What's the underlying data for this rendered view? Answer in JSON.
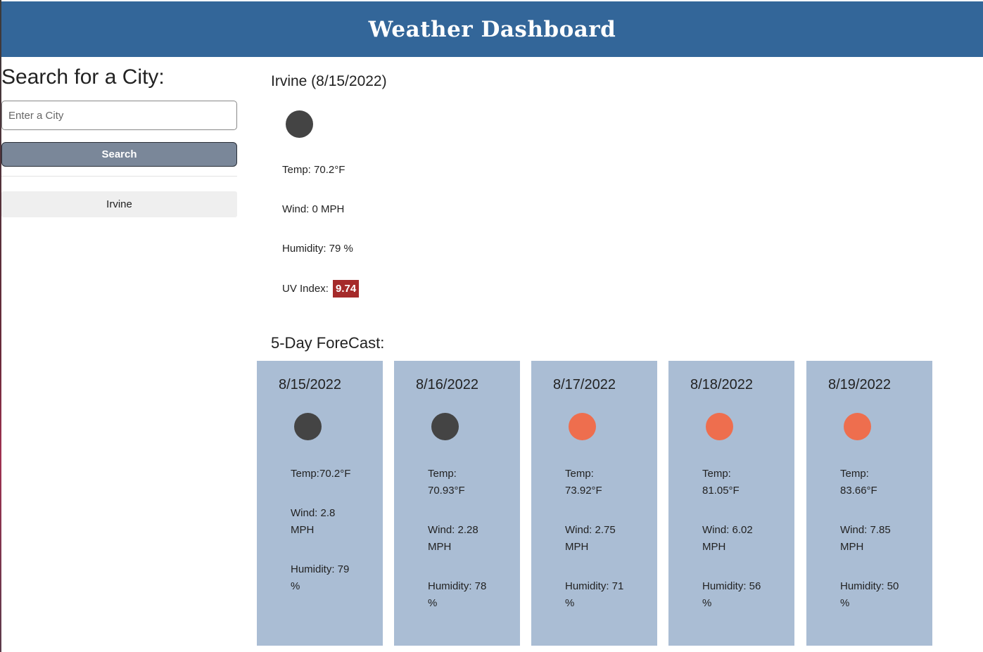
{
  "header": {
    "title": "Weather Dashboard"
  },
  "search": {
    "heading": "Search for a City:",
    "placeholder": "Enter a City",
    "button_label": "Search"
  },
  "history": [
    {
      "label": "Irvine"
    }
  ],
  "current": {
    "title": "Irvine (8/15/2022)",
    "icon": "weather-icon",
    "icon_color": "#444444",
    "temp": "Temp: 70.2°F",
    "wind": "Wind: 0 MPH",
    "humidity": "Humidity: 79 %",
    "uv_label": "UV Index:",
    "uv_value": "9.74",
    "uv_color": "#a52a2a"
  },
  "forecast": {
    "title": "5-Day ForeCast:",
    "days": [
      {
        "date": "8/15/2022",
        "icon_color": "#444444",
        "temp_label": "Temp:",
        "temp_value": "70.2°F",
        "wind_label": "Wind: 2.8",
        "wind_unit": "MPH",
        "humidity_label": "Humidity: 79",
        "humidity_unit": "%"
      },
      {
        "date": "8/16/2022",
        "icon_color": "#444444",
        "temp_label": "Temp:",
        "temp_value": "70.93°F",
        "wind_label": "Wind: 2.28",
        "wind_unit": "MPH",
        "humidity_label": "Humidity: 78",
        "humidity_unit": "%"
      },
      {
        "date": "8/17/2022",
        "icon_color": "#ee6e4e",
        "temp_label": "Temp:",
        "temp_value": "73.92°F",
        "wind_label": "Wind: 2.75",
        "wind_unit": "MPH",
        "humidity_label": "Humidity: 71",
        "humidity_unit": "%"
      },
      {
        "date": "8/18/2022",
        "icon_color": "#ee6e4e",
        "temp_label": "Temp:",
        "temp_value": "81.05°F",
        "wind_label": "Wind: 6.02",
        "wind_unit": "MPH",
        "humidity_label": "Humidity: 56",
        "humidity_unit": "%"
      },
      {
        "date": "8/19/2022",
        "icon_color": "#ee6e4e",
        "temp_label": "Temp:",
        "temp_value": "83.66°F",
        "wind_label": "Wind: 7.85",
        "wind_unit": "MPH",
        "humidity_label": "Humidity: 50",
        "humidity_unit": "%"
      }
    ]
  },
  "colors": {
    "header_bg": "#336699",
    "card_bg": "#aabdd4",
    "button_bg": "#7a8799"
  }
}
